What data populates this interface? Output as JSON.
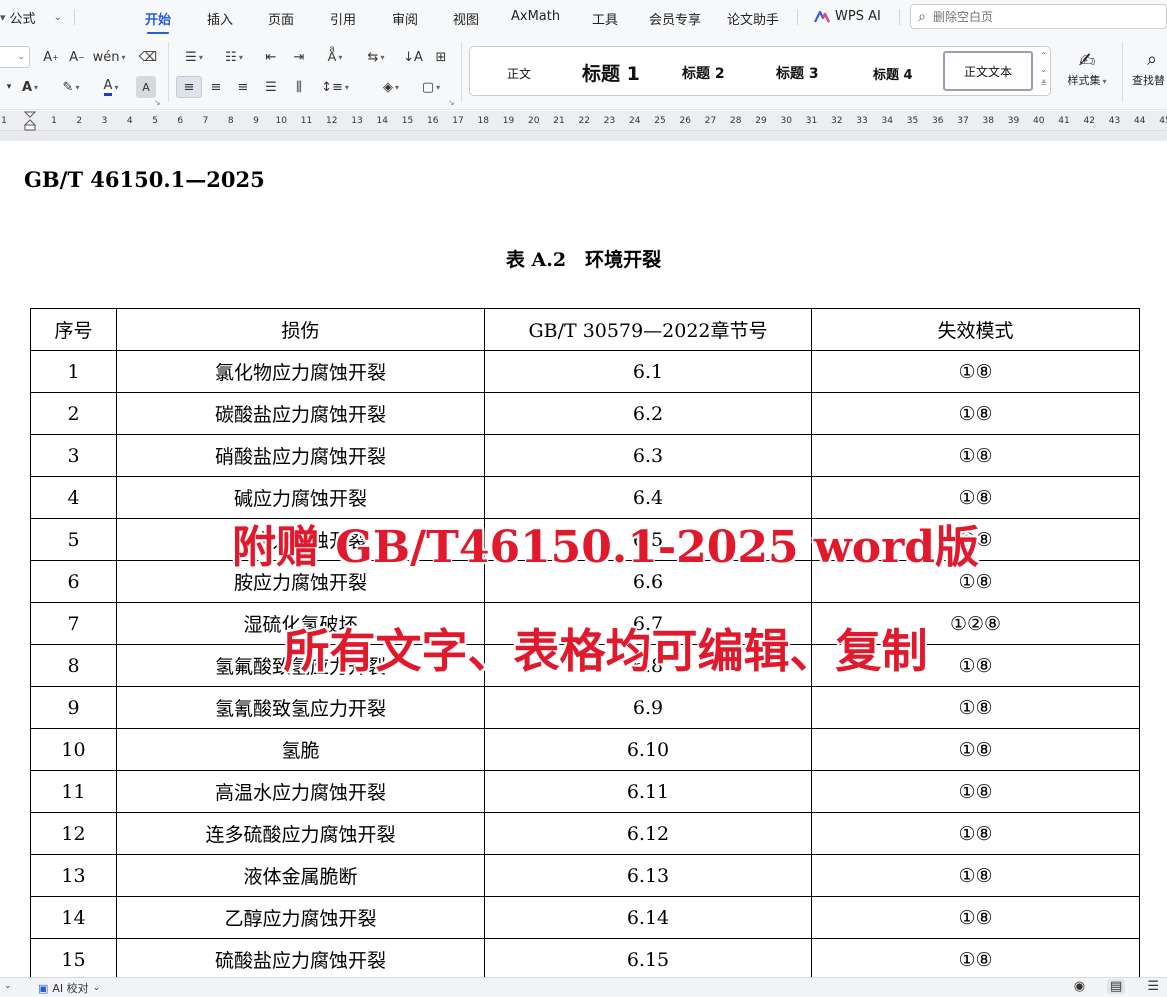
{
  "menu": {
    "formula_label": "公式",
    "tabs": [
      {
        "label": "开始",
        "active": true
      },
      {
        "label": "插入"
      },
      {
        "label": "页面"
      },
      {
        "label": "引用"
      },
      {
        "label": "审阅"
      },
      {
        "label": "视图"
      },
      {
        "label": "AxMath"
      },
      {
        "label": "工具"
      },
      {
        "label": "会员专享"
      },
      {
        "label": "论文助手"
      },
      {
        "label": "WPS AI"
      }
    ],
    "search_placeholder": "删除空白页",
    "accent_color": "#2a5cd6"
  },
  "toolbar": {
    "styles": {
      "normal": "正文",
      "heading1": "标题 1",
      "heading2": "标题 2",
      "heading3": "标题 3",
      "heading4": "标题 4",
      "body_text": "正文文本"
    },
    "style_set_label": "样式集",
    "find_label": "查找替"
  },
  "ruler": {
    "left_number": "1",
    "numbers": [
      "1",
      "2",
      "3",
      "4",
      "5",
      "6",
      "7",
      "8",
      "9",
      "10",
      "11",
      "12",
      "13",
      "14",
      "15",
      "16",
      "17",
      "18",
      "19",
      "20",
      "21",
      "22",
      "23",
      "24",
      "25",
      "26",
      "27",
      "28",
      "29",
      "30",
      "31",
      "32",
      "33",
      "34",
      "35",
      "36",
      "37",
      "38",
      "39",
      "40",
      "41",
      "42",
      "43",
      "44",
      "45"
    ]
  },
  "document": {
    "header": "GB/T 46150.1—2025",
    "caption": "表 A.2　环境开裂",
    "table": {
      "headers": [
        "序号",
        "损伤",
        "GB/T 30579—2022章节号",
        "失效模式"
      ],
      "rows": [
        [
          "1",
          "氯化物应力腐蚀开裂",
          "6.1",
          "①⑧"
        ],
        [
          "2",
          "碳酸盐应力腐蚀开裂",
          "6.2",
          "①⑧"
        ],
        [
          "3",
          "硝酸盐应力腐蚀开裂",
          "6.3",
          "①⑧"
        ],
        [
          "4",
          "碱应力腐蚀开裂",
          "6.4",
          "①⑧"
        ],
        [
          "5",
          "氨应力腐蚀开裂",
          "6.5",
          "①⑧"
        ],
        [
          "6",
          "胺应力腐蚀开裂",
          "6.6",
          "①⑧"
        ],
        [
          "7",
          "湿硫化氢破坏",
          "6.7",
          "①②⑧"
        ],
        [
          "8",
          "氢氟酸致氢应力开裂",
          "6.8",
          "①⑧"
        ],
        [
          "9",
          "氢氰酸致氢应力开裂",
          "6.9",
          "①⑧"
        ],
        [
          "10",
          "氢脆",
          "6.10",
          "①⑧"
        ],
        [
          "11",
          "高温水应力腐蚀开裂",
          "6.11",
          "①⑧"
        ],
        [
          "12",
          "连多硫酸应力腐蚀开裂",
          "6.12",
          "①⑧"
        ],
        [
          "13",
          "液体金属脆断",
          "6.13",
          "①⑧"
        ],
        [
          "14",
          "乙醇应力腐蚀开裂",
          "6.14",
          "①⑧"
        ],
        [
          "15",
          "硫酸盐应力腐蚀开裂",
          "6.15",
          "①⑧"
        ]
      ]
    },
    "promo_line1": "附赠 GB/T46150.1-2025 word版",
    "promo_line2": "所有文字、表格均可编辑、复制",
    "promo_color": "#e0192c"
  },
  "status": {
    "ai_check_label": "AI 校对"
  }
}
